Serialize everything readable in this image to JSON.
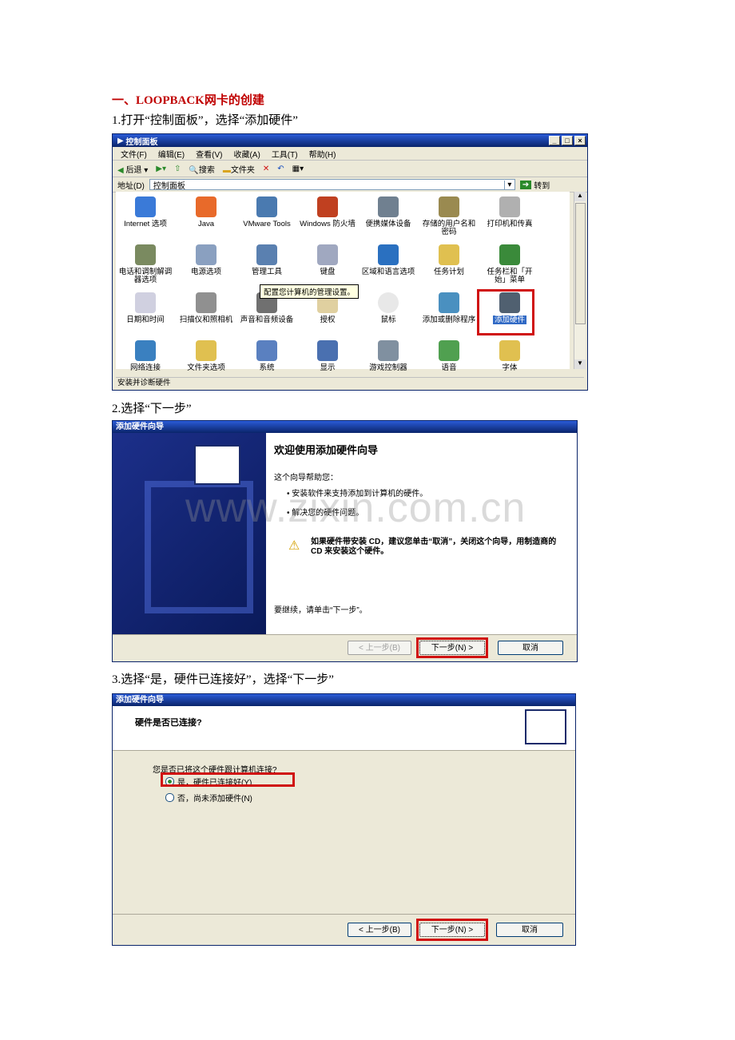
{
  "heading": "一、LOOPBACK网卡的创建",
  "step1": "1.打开“控制面板”，选择“添加硬件”",
  "step2": "2.选择“下一步”",
  "step3": "3.选择“是，硬件已连接好”，选择“下一步”",
  "watermark": "www.zixin.com.cn",
  "cp": {
    "title": "控制面板",
    "menu": [
      "文件(F)",
      "编辑(E)",
      "查看(V)",
      "收藏(A)",
      "工具(T)",
      "帮助(H)"
    ],
    "toolbar": [
      "后退",
      "搜索",
      "文件夹"
    ],
    "address_label": "地址(D)",
    "address_value": "控制面板",
    "go": "转到",
    "items": [
      "Internet 选项",
      "Java",
      "VMware Tools",
      "Windows 防火墙",
      "便携媒体设备",
      "存储的用户名和密码",
      "打印机和传真",
      "电话和调制解调器选项",
      "电源选项",
      "管理工具",
      "键盘",
      "区域和语言选项",
      "任务计划",
      "任务栏和「开始」菜单",
      "日期和时间",
      "扫描仪和照相机",
      "声音和音频设备",
      "授权",
      "鼠标",
      "添加或删除程序",
      "添加硬件",
      "网络连接",
      "文件夹选项",
      "系统",
      "显示",
      "游戏控制器",
      "语音",
      "字体"
    ],
    "tooltip": "配置您计算机的管理设置。",
    "status": "安装并诊断硬件"
  },
  "wiz1": {
    "title": "添加硬件向导",
    "heading": "欢迎使用添加硬件向导",
    "intro": "这个向导帮助您：",
    "bullet1": "安装软件来支持添加到计算机的硬件。",
    "bullet2": "解决您的硬件问题。",
    "warn": "如果硬件带安装 CD，建议您单击“取消”，关闭这个向导，用制造商的 CD 来安装这个硬件。",
    "continue": "要继续，请单击“下一步”。",
    "back": "< 上一步(B)",
    "next": "下一步(N) >",
    "cancel": "取消"
  },
  "wiz2": {
    "title": "添加硬件向导",
    "heading": "硬件是否已连接?",
    "question": "您是否已将这个硬件跟计算机连接?",
    "opt_yes": "是，硬件已连接好(Y)",
    "opt_no": "否，尚未添加硬件(N)",
    "back": "< 上一步(B)",
    "next": "下一步(N) >",
    "cancel": "取消"
  }
}
